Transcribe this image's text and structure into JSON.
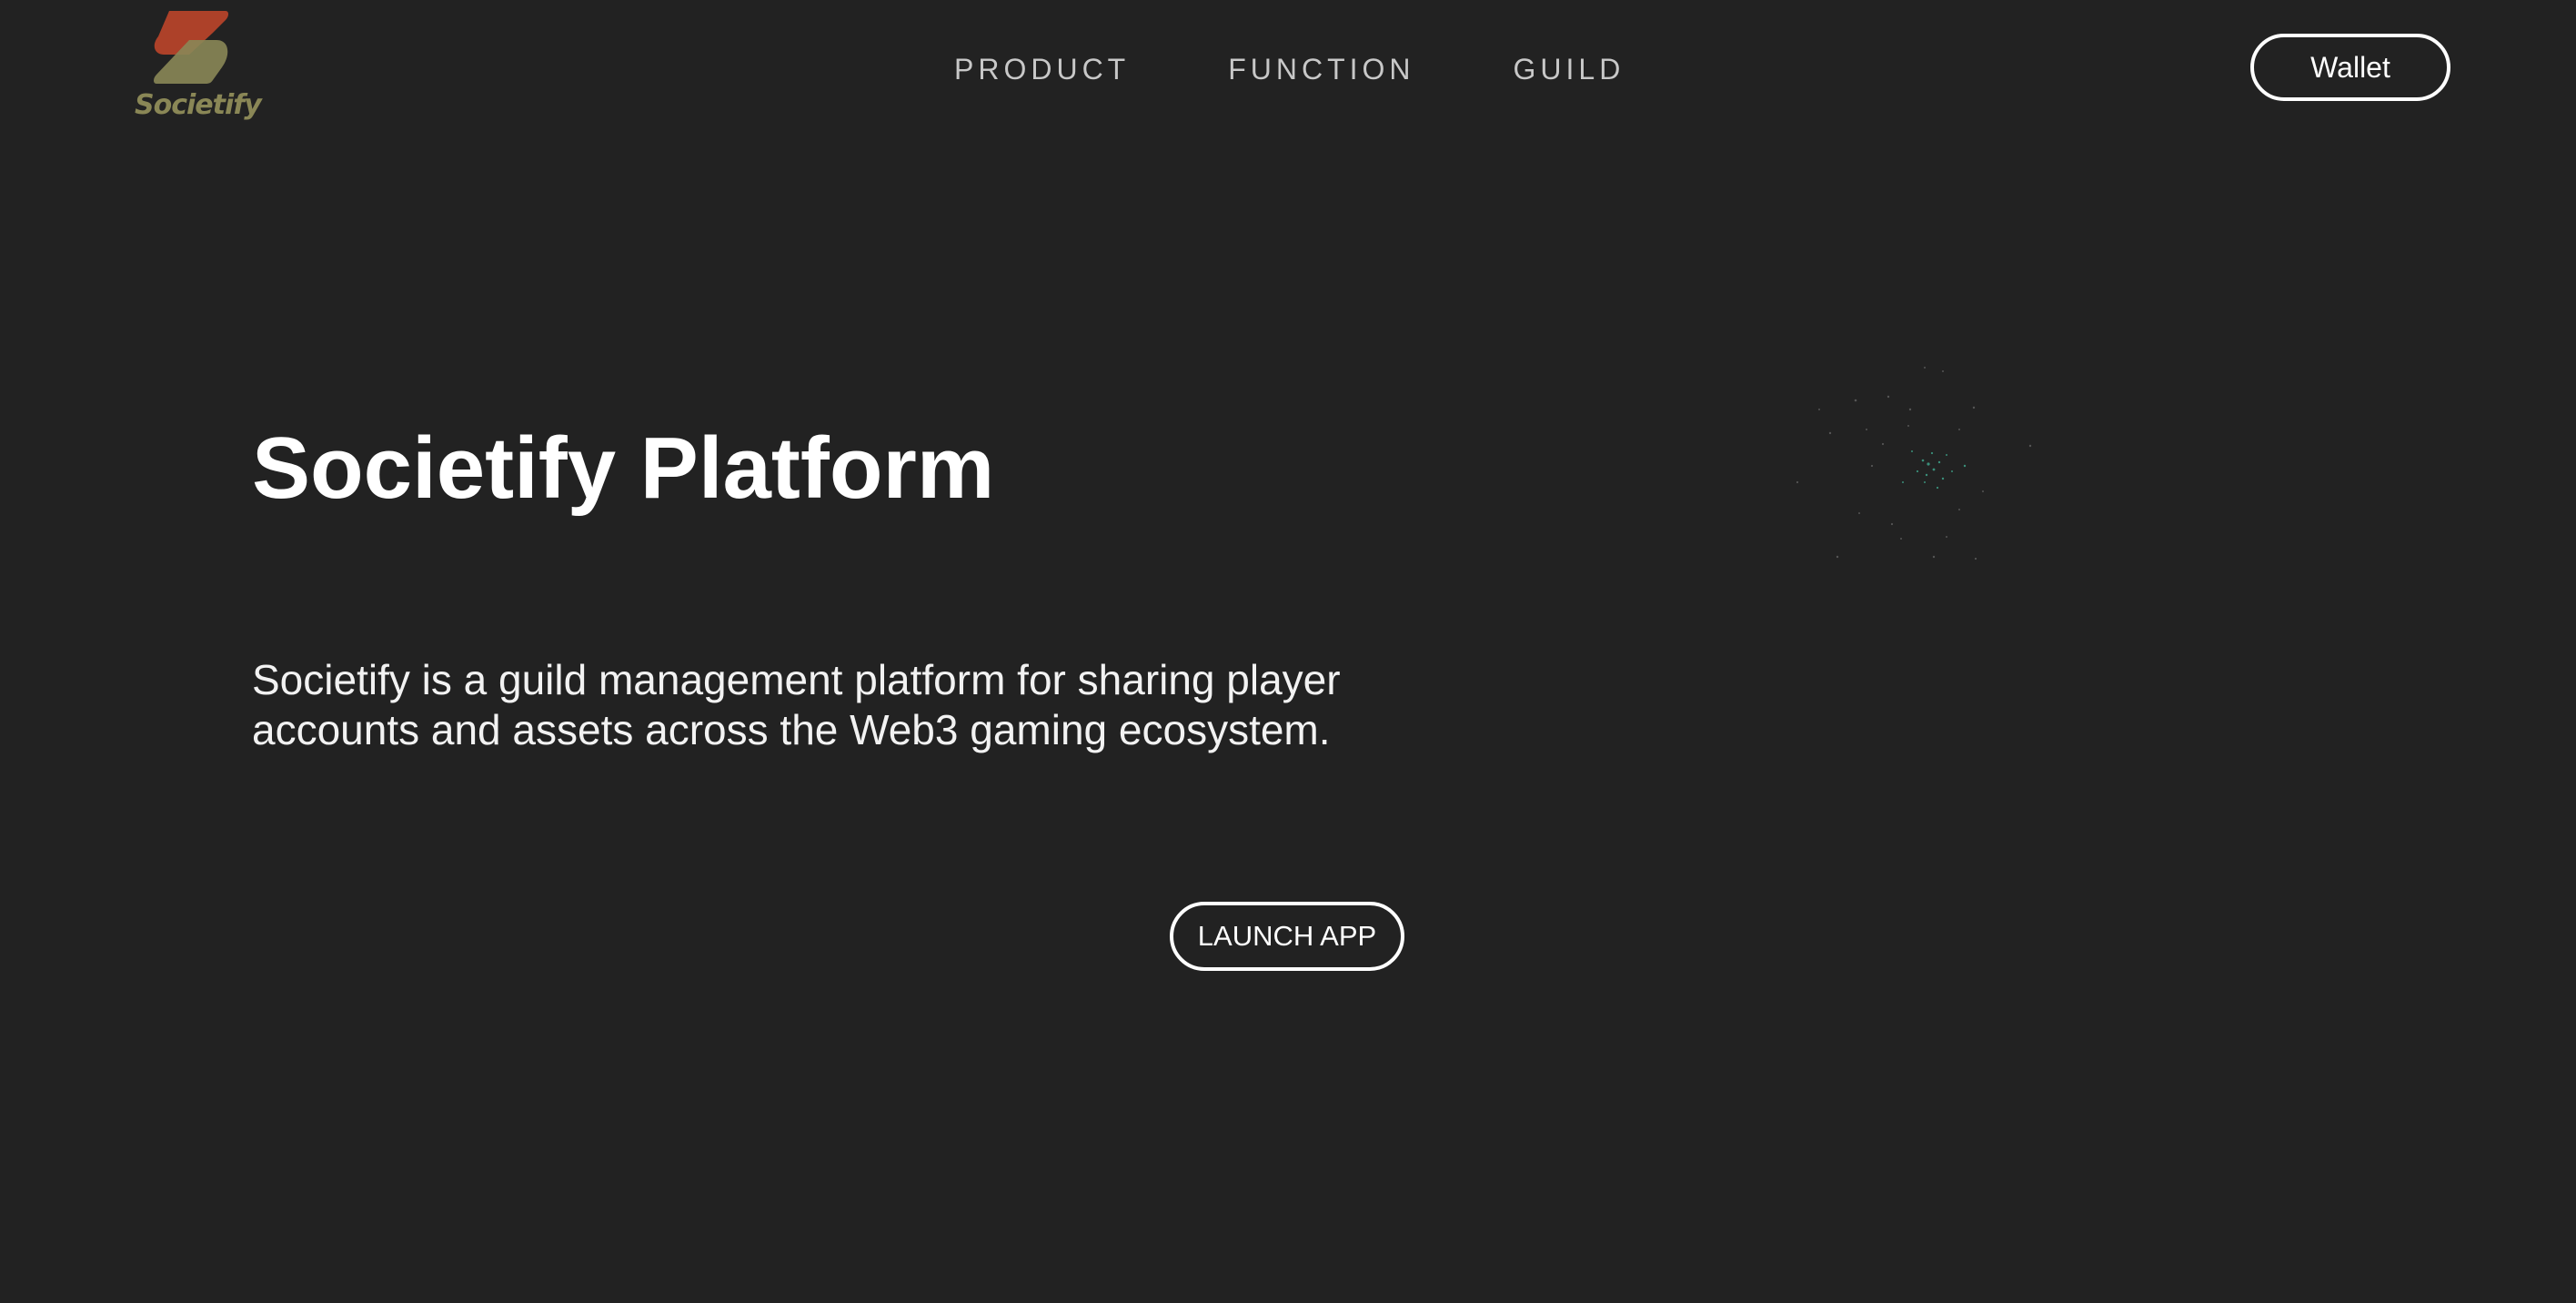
{
  "header": {
    "logo_text": "Societify",
    "nav": [
      {
        "label": "PRODUCT"
      },
      {
        "label": "FUNCTION"
      },
      {
        "label": "GUILD"
      }
    ],
    "wallet_label": "Wallet"
  },
  "hero": {
    "title": "Societify Platform",
    "description": "Societify is a guild management platform for sharing player accounts and assets across the Web3 gaming ecosystem.",
    "cta_label": "LAUNCH APP"
  },
  "colors": {
    "background": "#222222",
    "logo_top": "#b5432a",
    "logo_bottom": "#8a8756",
    "particles": "#2ec7a0"
  },
  "icons": {
    "logo": "societify-s-logo-icon",
    "decoration": "particle-cloud-icon"
  }
}
